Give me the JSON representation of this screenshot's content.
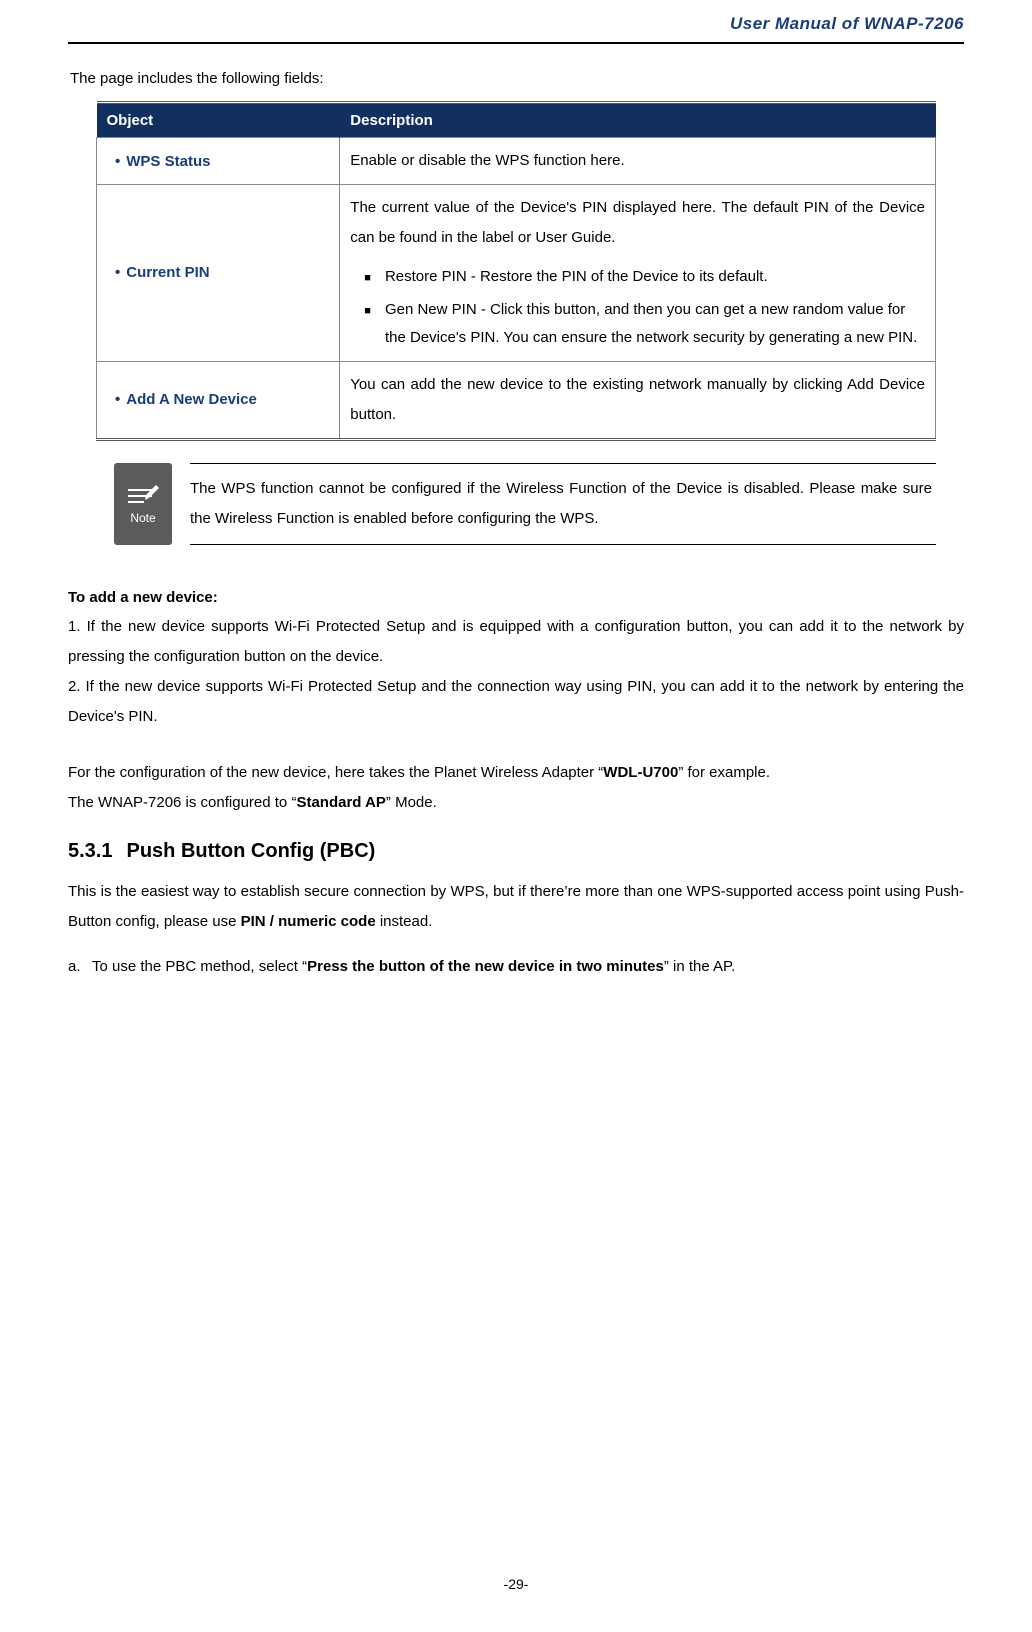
{
  "header": {
    "title": "User Manual of WNAP-7206"
  },
  "intro": "The page includes the following fields:",
  "table": {
    "headers": {
      "object": "Object",
      "description": "Description"
    },
    "rows": [
      {
        "object": "WPS Status",
        "description": "Enable or disable the WPS function here."
      },
      {
        "object": "Current PIN",
        "intro": "The current value of the Device's PIN displayed here. The default PIN of the Device can be found in the label or User Guide.",
        "bullets": [
          "Restore PIN - Restore the PIN of the Device to its default.",
          "Gen New PIN - Click this button, and then you can get a new random value for the Device's PIN. You can ensure the network security by generating a new PIN."
        ]
      },
      {
        "object": "Add A New Device",
        "description": "You can add the new device to the existing network manually by clicking Add Device button."
      }
    ]
  },
  "note": {
    "label": "Note",
    "text": "The WPS function cannot be configured if the Wireless Function of the Device is disabled. Please make sure the Wireless Function is enabled before configuring the WPS."
  },
  "section_add": {
    "heading": "To add a new device:",
    "step1": "1. If the new device supports Wi-Fi Protected Setup and is equipped with a configuration button, you can add it to the network by pressing the configuration button on the device.",
    "step2": "2. If the new device supports Wi-Fi Protected Setup and the connection way using PIN, you can add it to the network by entering the Device's PIN.",
    "example_prefix": "For the configuration of the new device, here takes the Planet Wireless Adapter “",
    "example_bold": "WDL-U700",
    "example_suffix": "” for example.",
    "mode_prefix": "The WNAP-7206 is configured to “",
    "mode_bold": "Standard AP",
    "mode_suffix": "” Mode."
  },
  "section_531": {
    "number": "5.3.1",
    "title": "Push Button Config (PBC)",
    "para_prefix": "This is the easiest way to establish secure connection by WPS, but if there’re more than one WPS-supported access point using Push-Button config, please use ",
    "para_bold": "PIN / numeric code",
    "para_suffix": " instead.",
    "item_a_marker": "a.",
    "item_a_prefix": "To use the PBC method, select “",
    "item_a_bold": "Press the button of the new device in two minutes",
    "item_a_suffix": "” in the AP."
  },
  "footer": {
    "page": "-29-"
  }
}
